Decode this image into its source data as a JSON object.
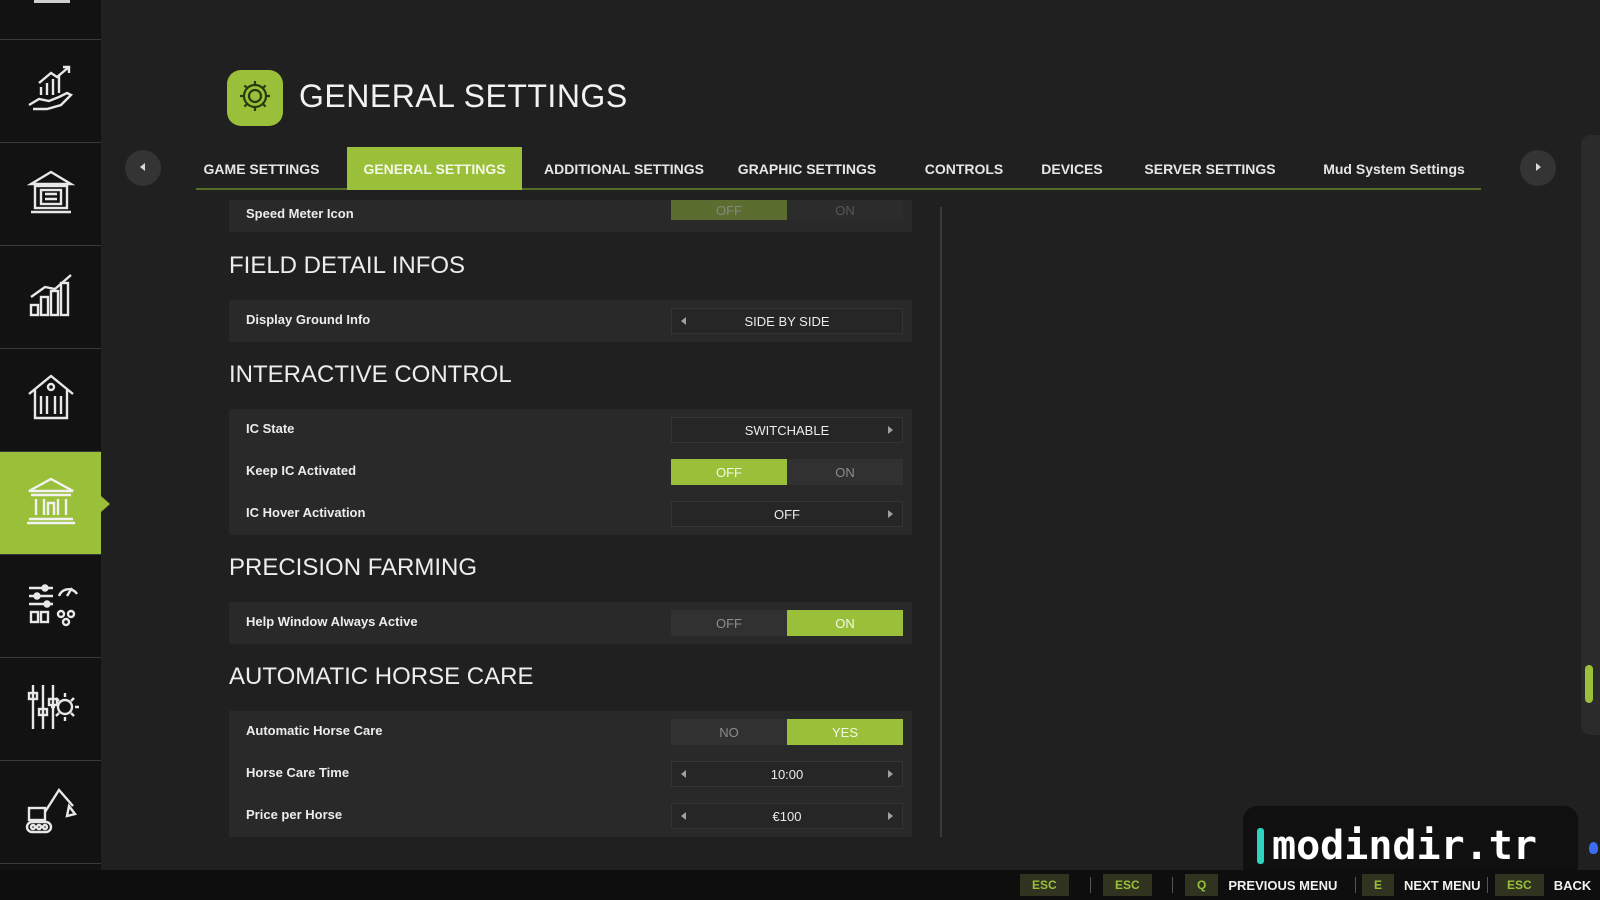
{
  "sidebar": {
    "items": [
      {
        "icon": "hand-growth-chart-icon"
      },
      {
        "icon": "calculator-building-icon"
      },
      {
        "icon": "bar-chart-icon"
      },
      {
        "icon": "barn-icon"
      },
      {
        "icon": "bank-building-icon",
        "active": true
      },
      {
        "icon": "sliders-gauge-icon"
      },
      {
        "icon": "sliders-gear-icon"
      },
      {
        "icon": "construction-excavator-icon"
      }
    ]
  },
  "header": {
    "icon": "gear-icon",
    "title": "GENERAL SETTINGS"
  },
  "tabs": [
    {
      "label": "GAME SETTINGS"
    },
    {
      "label": "GENERAL SETTINGS",
      "active": true
    },
    {
      "label": "ADDITIONAL SETTINGS"
    },
    {
      "label": "GRAPHIC SETTINGS"
    },
    {
      "label": "CONTROLS"
    },
    {
      "label": "DEVICES"
    },
    {
      "label": "SERVER SETTINGS"
    },
    {
      "label": "Mud System Settings"
    }
  ],
  "settings": {
    "speed_meter": {
      "label": "Speed Meter Icon",
      "off": "OFF",
      "on": "ON",
      "value": "OFF"
    },
    "field_detail": {
      "heading": "FIELD DETAIL INFOS",
      "ground_info": {
        "label": "Display Ground Info",
        "value": "SIDE BY SIDE"
      }
    },
    "interactive_control": {
      "heading": "INTERACTIVE CONTROL",
      "ic_state": {
        "label": "IC State",
        "value": "SWITCHABLE"
      },
      "keep_ic": {
        "label": "Keep IC Activated",
        "off": "OFF",
        "on": "ON",
        "value": "OFF"
      },
      "ic_hover": {
        "label": "IC Hover Activation",
        "value": "OFF"
      }
    },
    "precision_farming": {
      "heading": "PRECISION FARMING",
      "help_window": {
        "label": "Help Window Always Active",
        "off": "OFF",
        "on": "ON",
        "value": "ON"
      }
    },
    "horse_care": {
      "heading": "AUTOMATIC HORSE CARE",
      "auto": {
        "label": "Automatic Horse Care",
        "off": "NO",
        "on": "YES",
        "value": "YES"
      },
      "time": {
        "label": "Horse Care Time",
        "value": "10:00"
      },
      "price": {
        "label": "Price per Horse",
        "value": "€100"
      }
    }
  },
  "watermark": {
    "text": "modindir.tr"
  },
  "bottom_bar": {
    "esc1": "ESC",
    "esc2": "ESC",
    "prev_key": "Q",
    "prev_label": "PREVIOUS MENU",
    "next_key": "E",
    "next_label": "NEXT MENU",
    "back_key": "ESC",
    "back_label": "BACK"
  },
  "colors": {
    "accent": "#9ac03a",
    "background": "#202020",
    "sidebar": "#121212"
  }
}
